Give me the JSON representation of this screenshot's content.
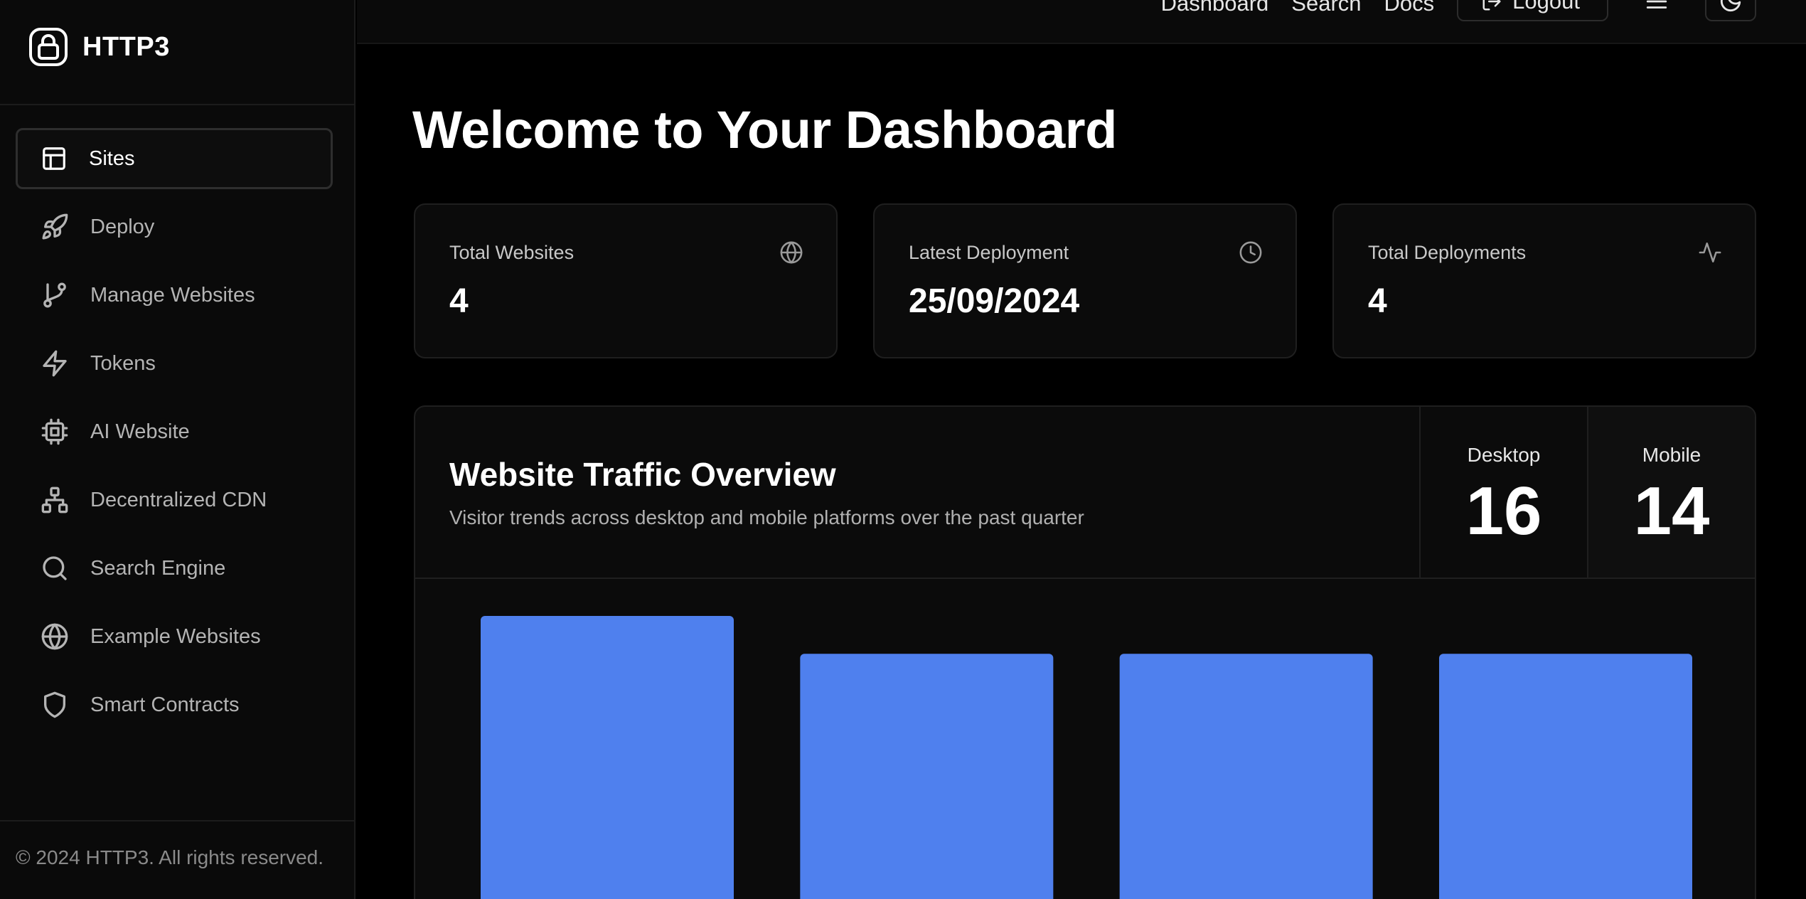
{
  "brand": {
    "name": "HTTP3"
  },
  "sidebar": {
    "items": [
      {
        "label": "Sites",
        "icon": "layout-icon",
        "active": true
      },
      {
        "label": "Deploy",
        "icon": "rocket-icon"
      },
      {
        "label": "Manage Websites",
        "icon": "git-branch-icon"
      },
      {
        "label": "Tokens",
        "icon": "lightning-icon"
      },
      {
        "label": "AI Website",
        "icon": "chip-icon"
      },
      {
        "label": "Decentralized CDN",
        "icon": "network-icon"
      },
      {
        "label": "Search Engine",
        "icon": "search-icon"
      },
      {
        "label": "Example Websites",
        "icon": "globe-icon"
      },
      {
        "label": "Smart Contracts",
        "icon": "shield-icon"
      }
    ],
    "footer": "© 2024 HTTP3. All rights reserved."
  },
  "topnav": {
    "links": [
      "Dashboard",
      "Search",
      "Docs"
    ],
    "logout_label": "Logout"
  },
  "main": {
    "title": "Welcome to Your Dashboard",
    "stats": [
      {
        "label": "Total Websites",
        "value": "4",
        "icon": "globe-icon"
      },
      {
        "label": "Latest Deployment",
        "value": "25/09/2024",
        "icon": "clock-icon"
      },
      {
        "label": "Total Deployments",
        "value": "4",
        "icon": "activity-icon"
      }
    ],
    "traffic": {
      "title": "Website Traffic Overview",
      "subtitle": "Visitor trends across desktop and mobile platforms over the past quarter",
      "desktop_label": "Desktop",
      "desktop_value": "16",
      "mobile_label": "Mobile",
      "mobile_value": "14"
    }
  },
  "colors": {
    "accent": "#4f80ee",
    "background": "#000000",
    "card": "#0b0b0b"
  },
  "chart_data": {
    "type": "bar",
    "categories": [
      "",
      "",
      "",
      ""
    ],
    "values": [
      16,
      14,
      14,
      14
    ],
    "ylim": [
      0,
      17
    ],
    "grid": false
  }
}
